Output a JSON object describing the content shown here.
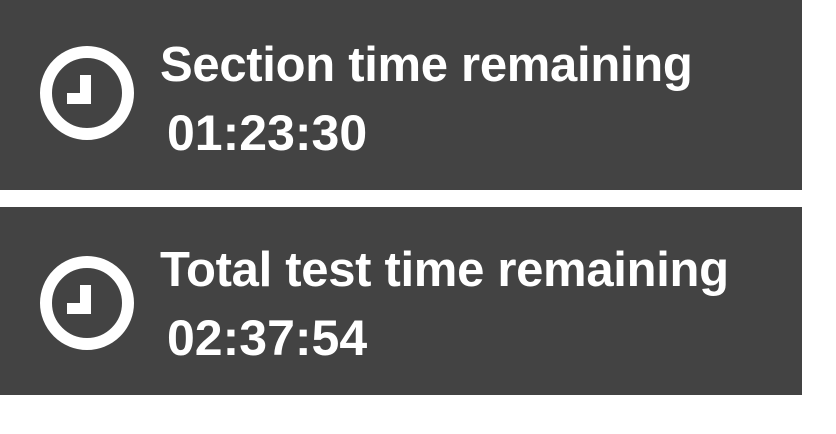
{
  "timers": {
    "section": {
      "icon": "clock-icon",
      "label": "Section time remaining",
      "time": "01:23:30"
    },
    "total": {
      "icon": "clock-icon",
      "label": "Total test time remaining",
      "time": "02:37:54"
    }
  },
  "colors": {
    "panel_background": "#434343",
    "text": "#ffffff",
    "page_background": "#ffffff"
  }
}
